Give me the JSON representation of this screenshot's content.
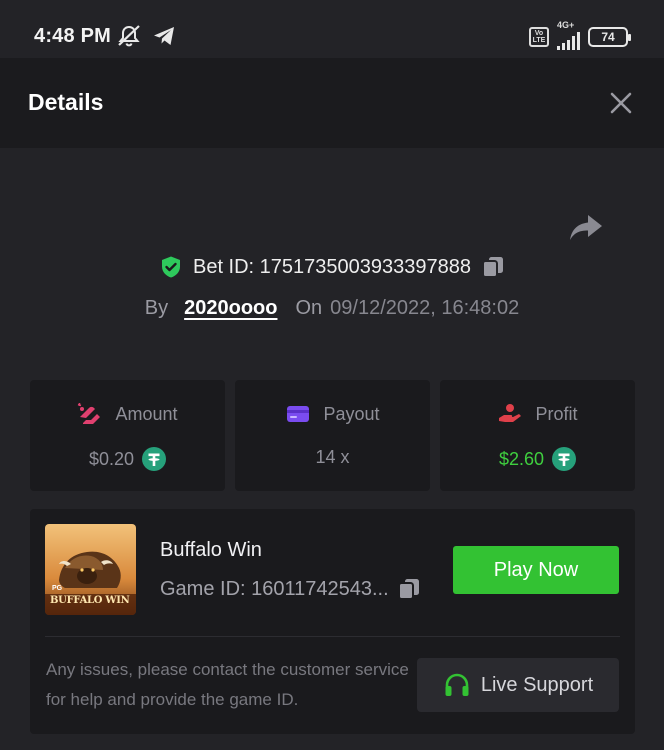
{
  "status_bar": {
    "time": "4:48 PM",
    "network": "4G+",
    "volte": "Vo LTE",
    "battery": "74"
  },
  "header": {
    "title": "Details"
  },
  "bet": {
    "id_label": "Bet ID: 1751735003933397888",
    "by_label": "By",
    "username": "2020oooo",
    "on_label": "On",
    "datetime": "09/12/2022, 16:48:02"
  },
  "stats": {
    "amount": {
      "label": "Amount",
      "value": "$0.20"
    },
    "payout": {
      "label": "Payout",
      "value": "14 x"
    },
    "profit": {
      "label": "Profit",
      "value": "$2.60"
    }
  },
  "game": {
    "name": "Buffalo Win",
    "id_label": "Game ID: 16011742543...",
    "thumb_brand": "PG",
    "thumb_title": "BUFFALO WIN",
    "play_label": "Play Now"
  },
  "support": {
    "text": "Any issues, please contact the customer service for help and provide the game ID.",
    "button_label": "Live Support"
  },
  "colors": {
    "background": "#232327",
    "header_bg": "#1b1b1e",
    "card_bg": "#1a1a1d",
    "accent_green": "#33c233",
    "profit_green": "#3fcf3f",
    "tether_green": "#26a17b",
    "amount_pink": "#e0406f",
    "payout_purple": "#7a4cf0",
    "profit_red": "#e0404a"
  },
  "icons": {
    "mute": "bell-off-icon",
    "telegram": "telegram-icon",
    "close": "close-icon",
    "share": "share-icon",
    "verified": "shield-check-icon",
    "copy": "copy-icon",
    "currency": "tether-icon",
    "support": "headset-icon"
  }
}
